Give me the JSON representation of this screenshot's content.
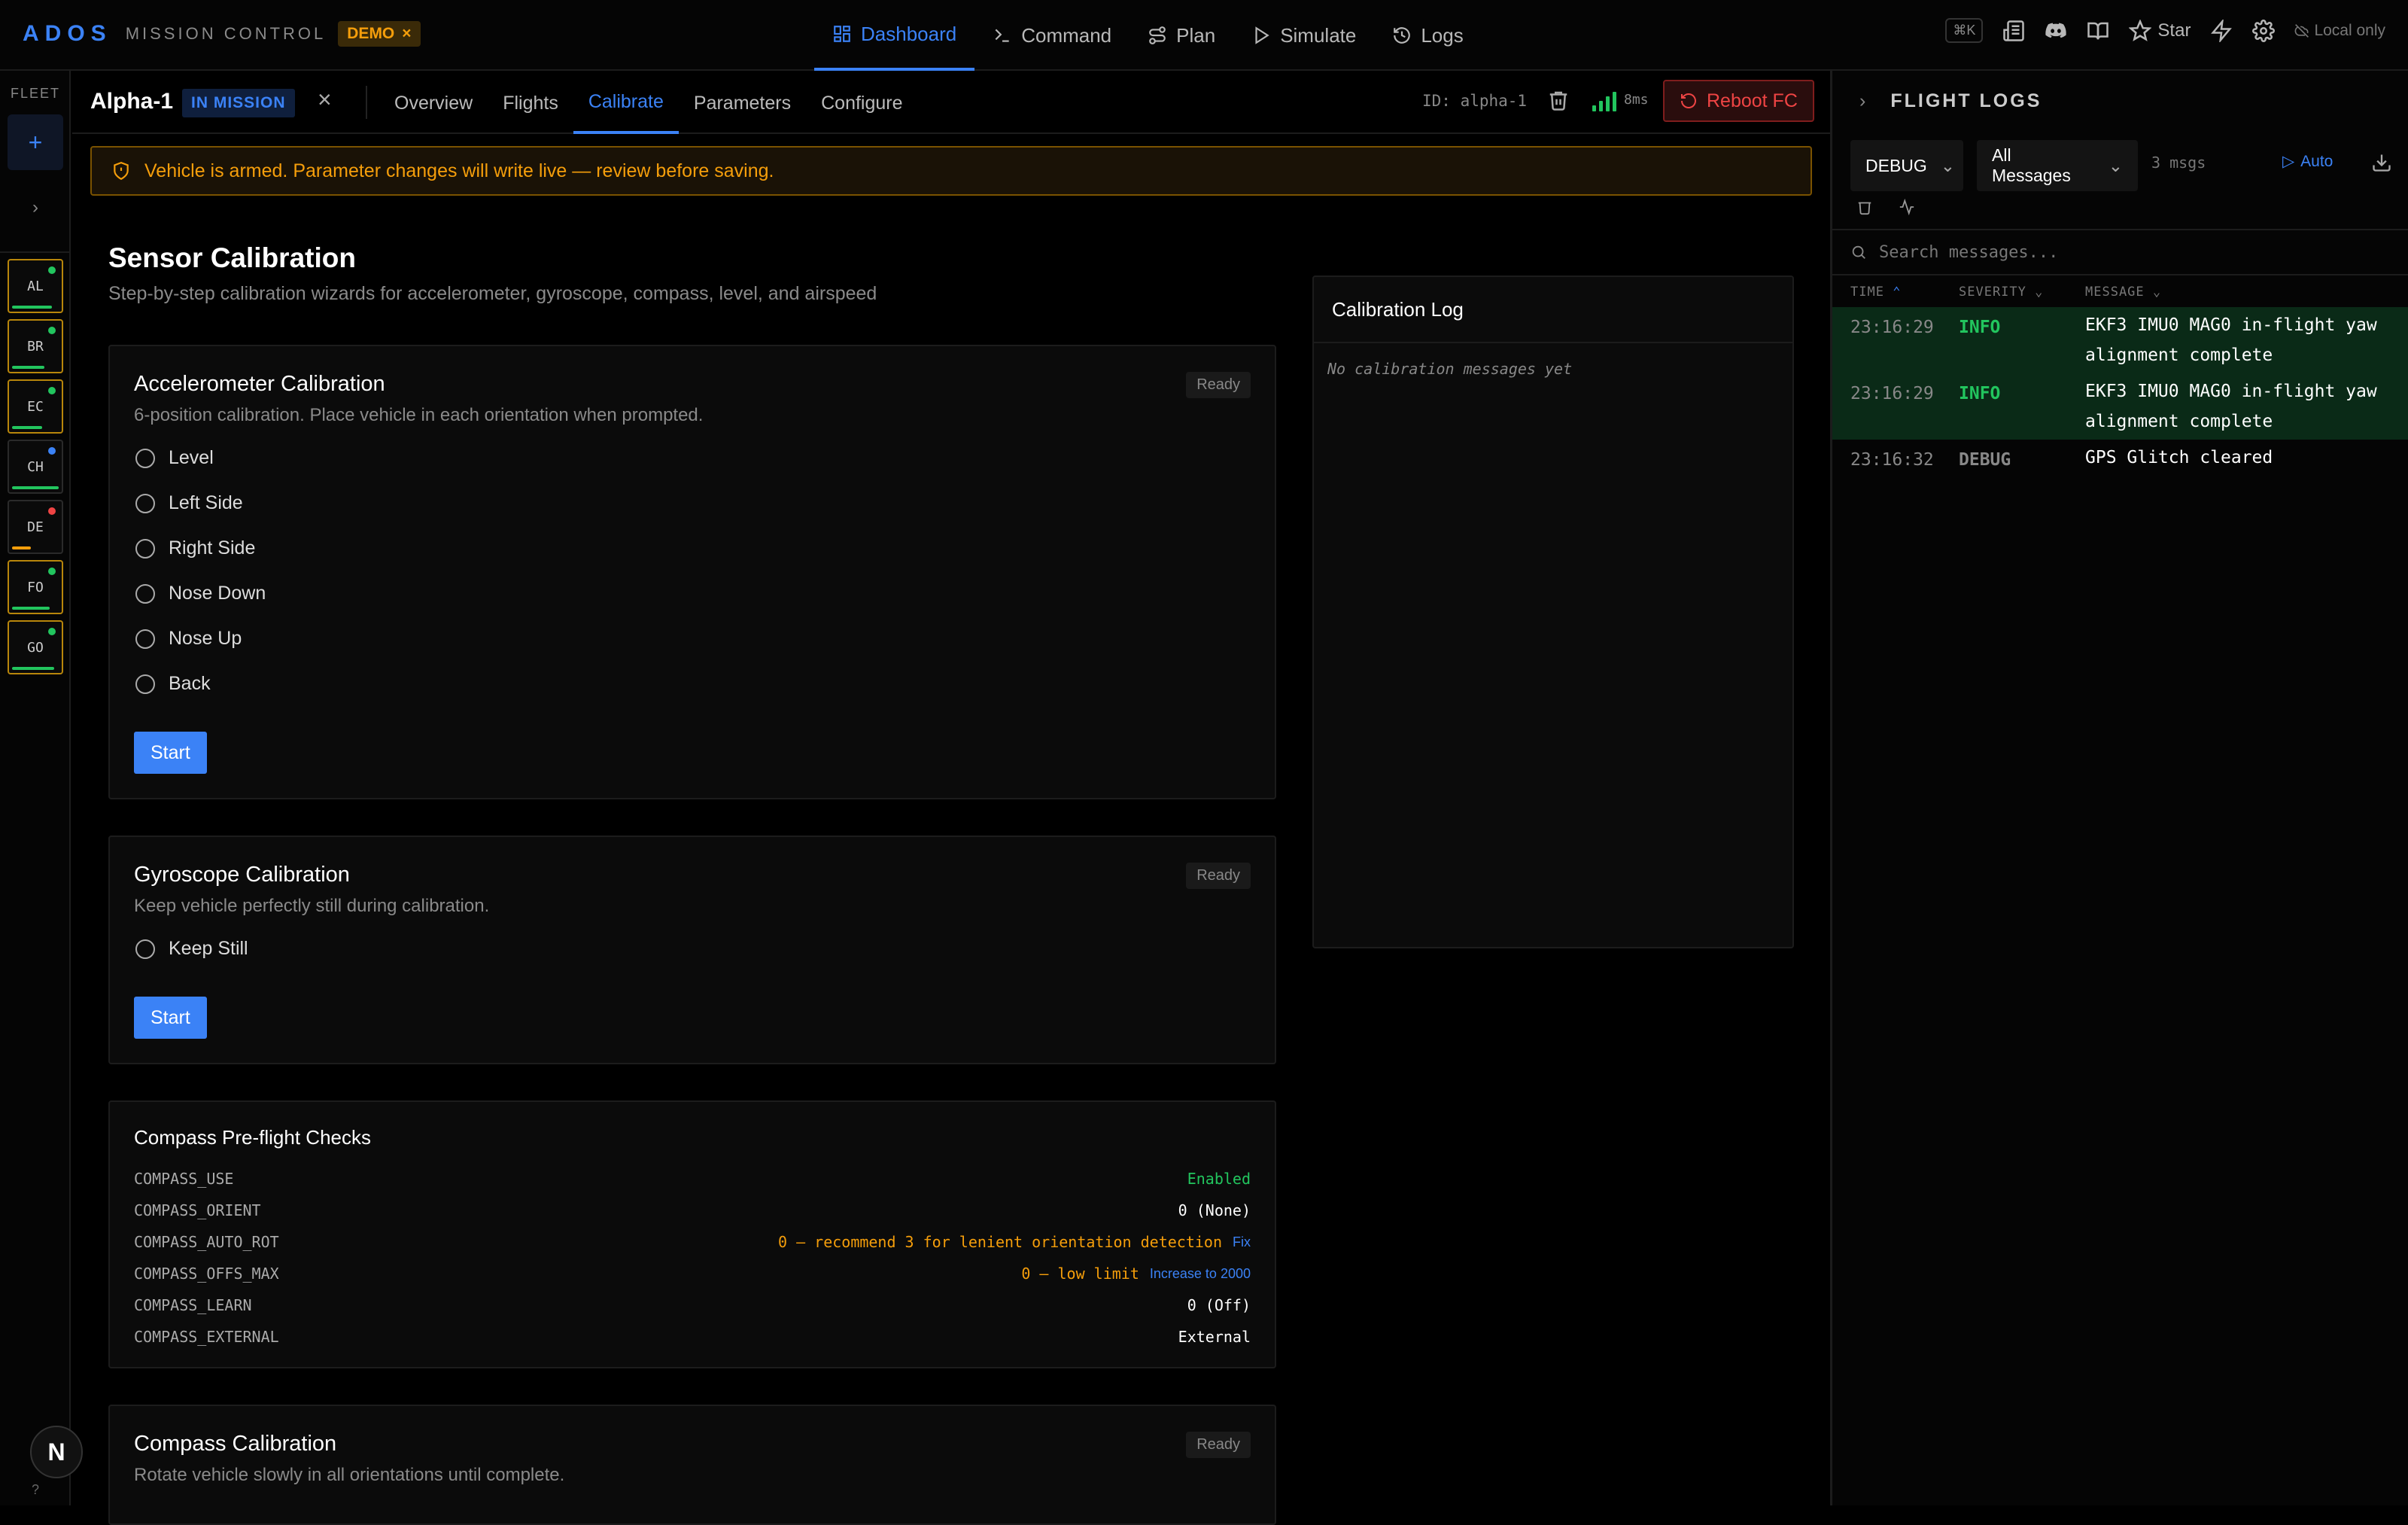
{
  "brand": {
    "logo": "ADOS",
    "subtitle": "MISSION CONTROL",
    "demo_badge": "DEMO"
  },
  "nav": [
    {
      "label": "Dashboard",
      "icon": "dashboard-icon",
      "active": true
    },
    {
      "label": "Command",
      "icon": "terminal-icon"
    },
    {
      "label": "Plan",
      "icon": "route-icon"
    },
    {
      "label": "Simulate",
      "icon": "play-icon"
    },
    {
      "label": "Logs",
      "icon": "history-icon"
    }
  ],
  "topright": {
    "shortcut": "⌘K",
    "star_label": "Star",
    "local_label": "Local only"
  },
  "fleet": {
    "label": "FLEET",
    "vehicles": [
      {
        "code": "AL",
        "status_color": "#22c55e",
        "bar_color": "#22c55e",
        "bar_fraction": 0.85,
        "highlighted": true
      },
      {
        "code": "BR",
        "status_color": "#22c55e",
        "bar_color": "#22c55e",
        "bar_fraction": 0.7,
        "highlighted": true
      },
      {
        "code": "EC",
        "status_color": "#22c55e",
        "bar_color": "#22c55e",
        "bar_fraction": 0.65,
        "highlighted": true
      },
      {
        "code": "CH",
        "status_color": "#3b82f6",
        "bar_color": "#22c55e",
        "bar_fraction": 1.0,
        "highlighted": false
      },
      {
        "code": "DE",
        "status_color": "#ef4444",
        "bar_color": "#f59e0b",
        "bar_fraction": 0.4,
        "highlighted": false
      },
      {
        "code": "FO",
        "status_color": "#22c55e",
        "bar_color": "#22c55e",
        "bar_fraction": 0.8,
        "highlighted": true
      },
      {
        "code": "GO",
        "status_color": "#22c55e",
        "bar_color": "#22c55e",
        "bar_fraction": 0.9,
        "highlighted": true
      }
    ],
    "help": "?"
  },
  "vehicle": {
    "name": "Alpha-1",
    "status": "IN MISSION",
    "tabs": [
      "Overview",
      "Flights",
      "Calibrate",
      "Parameters",
      "Configure"
    ],
    "active_tab": "Calibrate",
    "id_text": "ID: alpha-1",
    "latency": "8ms",
    "reboot_label": "Reboot FC"
  },
  "warning": "Vehicle is armed. Parameter changes will write live — review before saving.",
  "page": {
    "title": "Sensor Calibration",
    "subtitle": "Step-by-step calibration wizards for accelerometer, gyroscope, compass, level, and airspeed"
  },
  "accel": {
    "title": "Accelerometer Calibration",
    "desc": "6-position calibration. Place vehicle in each orientation when prompted.",
    "badge": "Ready",
    "positions": [
      "Level",
      "Left Side",
      "Right Side",
      "Nose Down",
      "Nose Up",
      "Back"
    ],
    "start_label": "Start"
  },
  "gyro": {
    "title": "Gyroscope Calibration",
    "desc": "Keep vehicle perfectly still during calibration.",
    "badge": "Ready",
    "positions": [
      "Keep Still"
    ],
    "start_label": "Start"
  },
  "compass_checks": {
    "title": "Compass Pre-flight Checks",
    "rows": [
      {
        "key": "COMPASS_USE",
        "value": "Enabled",
        "tone": "green",
        "action": ""
      },
      {
        "key": "COMPASS_ORIENT",
        "value": "0 (None)",
        "tone": "white",
        "action": ""
      },
      {
        "key": "COMPASS_AUTO_ROT",
        "value": "0 — recommend 3 for lenient orientation detection",
        "tone": "orange",
        "action": "Fix"
      },
      {
        "key": "COMPASS_OFFS_MAX",
        "value": "0 — low limit",
        "tone": "orange",
        "action": "Increase to 2000"
      },
      {
        "key": "COMPASS_LEARN",
        "value": "0 (Off)",
        "tone": "white",
        "action": ""
      },
      {
        "key": "COMPASS_EXTERNAL",
        "value": "External",
        "tone": "white",
        "action": ""
      }
    ]
  },
  "compass_cal": {
    "title": "Compass Calibration",
    "desc": "Rotate vehicle slowly in all orientations until complete.",
    "badge": "Ready"
  },
  "cal_log": {
    "title": "Calibration Log",
    "empty": "No calibration messages yet"
  },
  "flight_logs": {
    "title": "FLIGHT LOGS",
    "level": "DEBUG",
    "filter": "All Messages",
    "count": "3 msgs",
    "auto_label": "Auto",
    "search_placeholder": "Search messages...",
    "columns": [
      "TIME",
      "SEVERITY",
      "MESSAGE"
    ],
    "rows": [
      {
        "time": "23:16:29",
        "severity": "INFO",
        "message": "EKF3 IMU0 MAG0 in-flight yaw alignment complete"
      },
      {
        "time": "23:16:29",
        "severity": "INFO",
        "message": "EKF3 IMU0 MAG0 in-flight yaw alignment complete"
      },
      {
        "time": "23:16:32",
        "severity": "DEBUG",
        "message": "GPS Glitch cleared"
      }
    ]
  }
}
